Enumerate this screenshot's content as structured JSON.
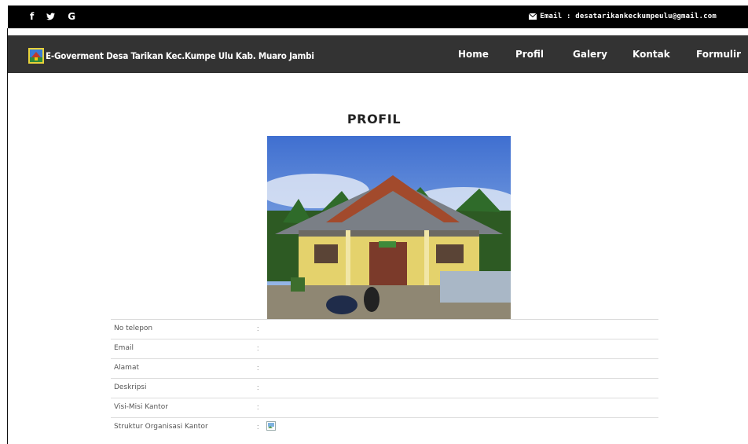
{
  "topbar": {
    "social": [
      "f",
      "twitter-bird",
      "G"
    ],
    "email_text": "Email : desatarikankeckumpeulu@gmail.com"
  },
  "navbar": {
    "brand": "E-Goverment Desa Tarikan Kec.Kumpe Ulu Kab. Muaro Jambi",
    "links": [
      "Home",
      "Profil",
      "Galery",
      "Kontak",
      "Formulir"
    ]
  },
  "page": {
    "title": "PROFIL",
    "rows": [
      {
        "label": "No telepon",
        "sep": ":"
      },
      {
        "label": "Email",
        "sep": ":"
      },
      {
        "label": "Alamat",
        "sep": ":"
      },
      {
        "label": "Deskripsi",
        "sep": ":"
      },
      {
        "label": "Visi-Misi Kantor",
        "sep": ":"
      },
      {
        "label": "Struktur Organisasi Kantor",
        "sep": ":"
      }
    ]
  },
  "colors": {
    "topbar_bg": "#000000",
    "navbar_bg": "#333333"
  }
}
